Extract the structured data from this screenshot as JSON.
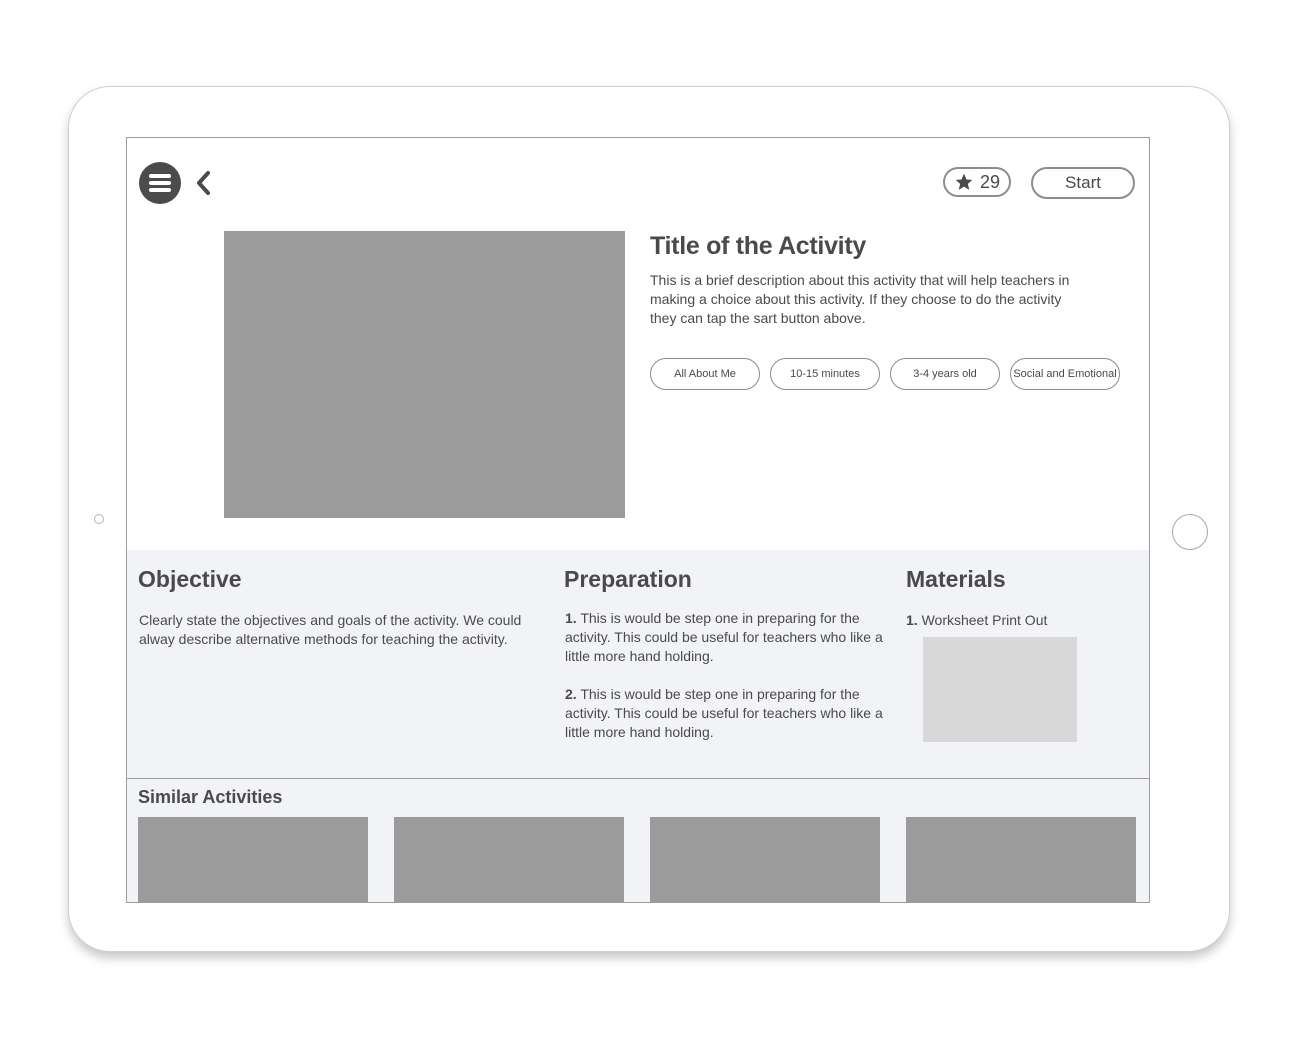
{
  "header": {
    "menu_icon": "hamburger-menu-icon",
    "back_icon": "chevron-left-icon",
    "favorite_icon": "star-icon",
    "favorite_count": "29",
    "start_label": "Start"
  },
  "activity": {
    "title": "Title of the Activity",
    "description": "This is a brief description about this activity that will help teachers in making a choice about this activity. If they choose to do the activity they can tap the sart button above.",
    "tags": [
      "All About Me",
      "10-15 minutes",
      "3-4 years old",
      "Social and Emotional"
    ]
  },
  "objective": {
    "heading": "Objective",
    "text": "Clearly state the objectives and goals of the activity. We could alway describe alternative methods for teaching the activity."
  },
  "preparation": {
    "heading": "Preparation",
    "steps": [
      {
        "num": "1.",
        "text": "This is would be step one in preparing for the activity. This could be useful for teachers who like a little more hand holding."
      },
      {
        "num": "2.",
        "text": "This is would be step one in preparing for the activity. This could be useful for teachers who like a little more hand holding."
      }
    ]
  },
  "materials": {
    "heading": "Materials",
    "items": [
      {
        "num": "1.",
        "text": "Worksheet Print Out"
      }
    ]
  },
  "similar": {
    "heading": "Similar Activities",
    "count": 4
  },
  "colors": {
    "icon_dark": "#4b4b4b",
    "placeholder_image": "#9b9b9b",
    "section_background": "#f2f3f7"
  }
}
